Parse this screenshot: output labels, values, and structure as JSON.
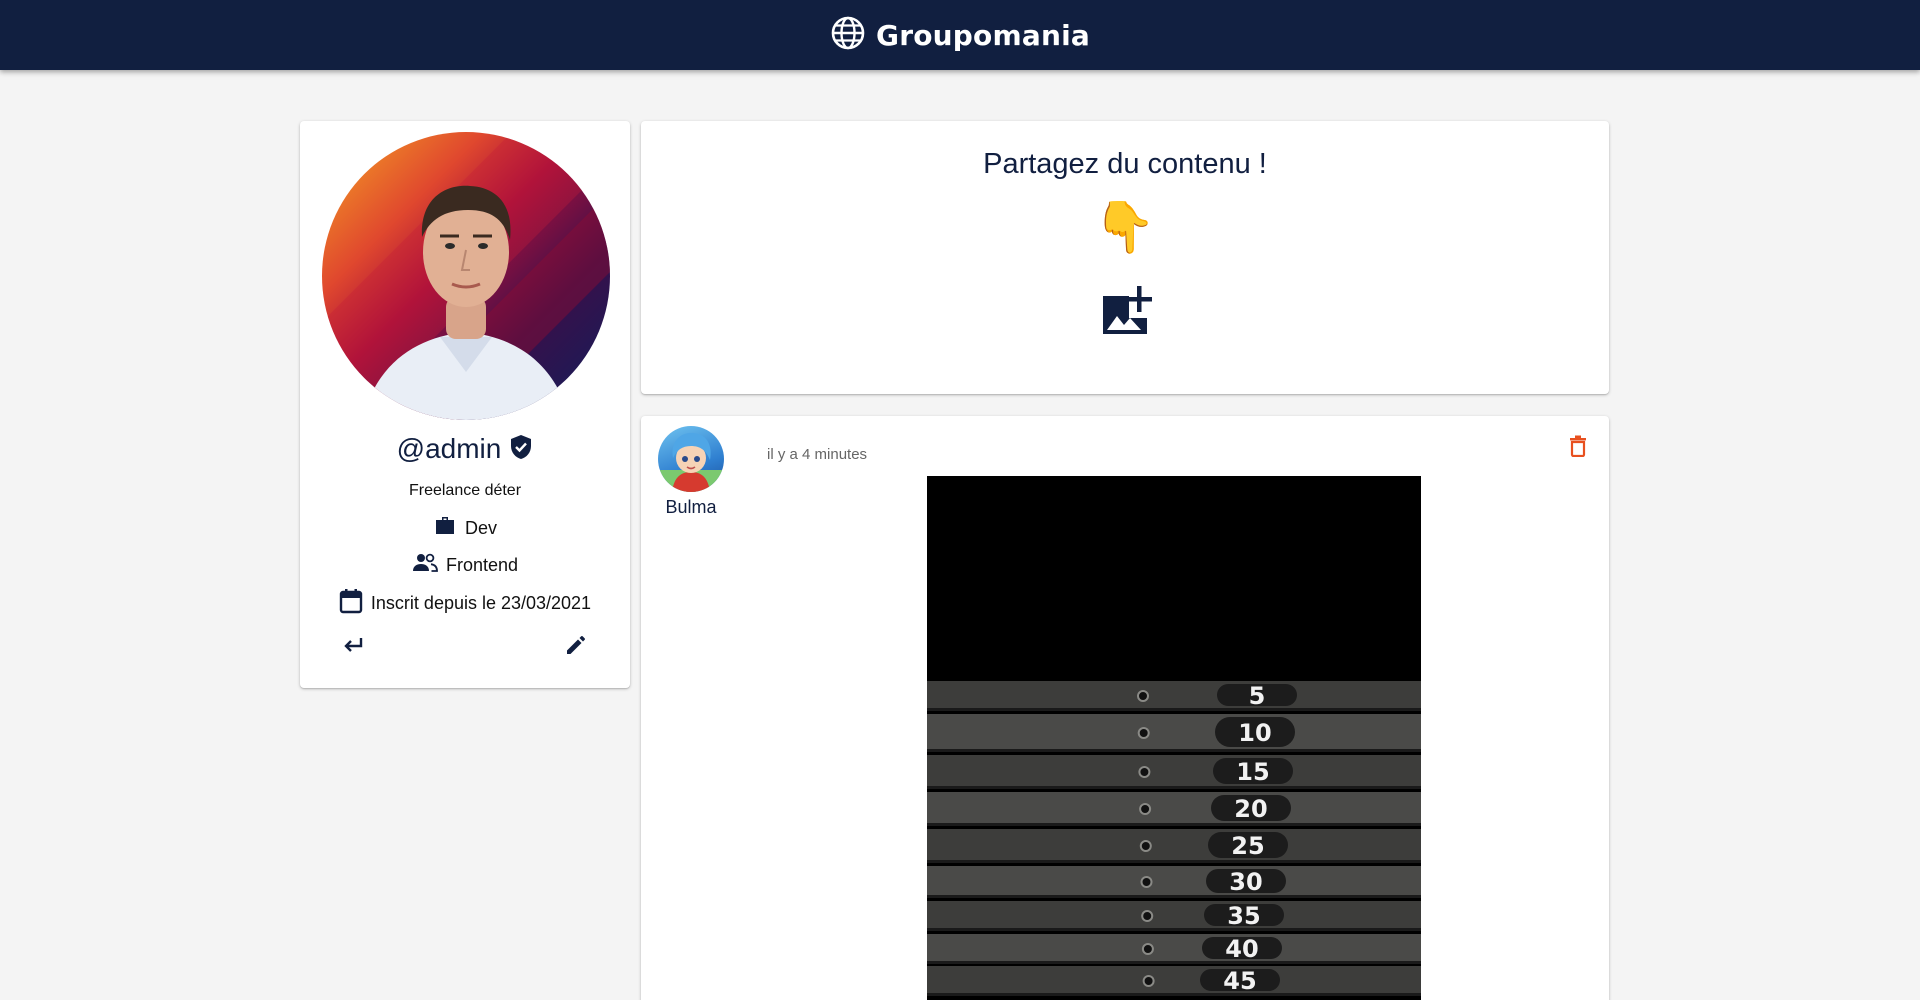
{
  "app": {
    "brand": "Groupomania",
    "brand_icon": "globe-icon"
  },
  "profile": {
    "username": "@admin",
    "verified_icon": "verified-shield-icon",
    "bio": "Freelance déter",
    "job": "Dev",
    "team": "Frontend",
    "registered": "Inscrit depuis le 23/03/2021",
    "icons": {
      "job": "briefcase-icon",
      "team": "people-icon",
      "date": "calendar-icon",
      "logout": "return-arrow-icon",
      "edit": "pencil-icon"
    }
  },
  "composer": {
    "title": "Partagez du contenu !",
    "emoji": "👇",
    "add_image_icon": "add-photo-icon"
  },
  "posts": [
    {
      "author": "Bulma",
      "time": "il y a 4 minutes",
      "delete_icon": "trash-icon",
      "image_plate_labels": [
        "5",
        "10",
        "15",
        "20",
        "25",
        "30",
        "35",
        "40",
        "45"
      ]
    }
  ],
  "colors": {
    "header_bg": "#111f40",
    "page_bg": "#f4f4f4",
    "primary_text": "#111f40",
    "delete": "#e8501f"
  }
}
